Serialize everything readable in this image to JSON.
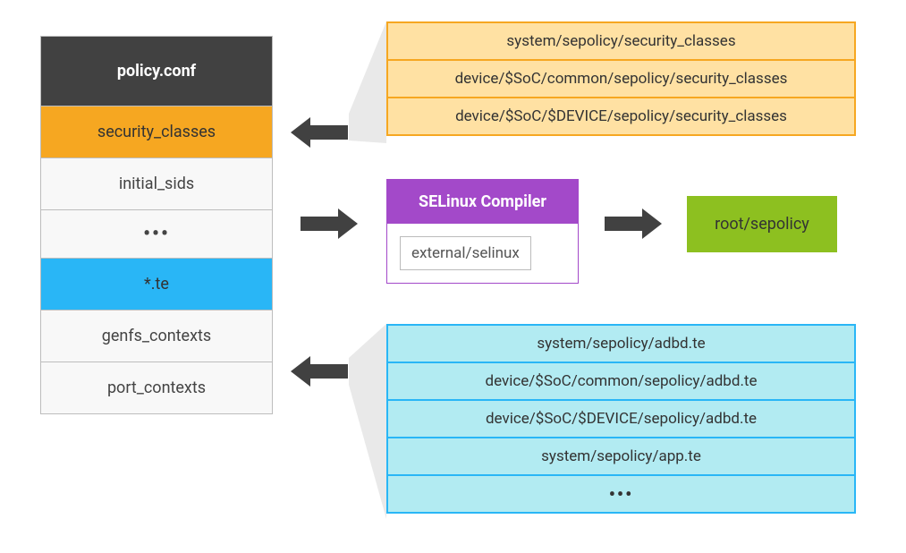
{
  "policy": {
    "header": "policy.conf",
    "rows": {
      "security_classes": "security_classes",
      "initial_sids": "initial_sids",
      "ellipsis": "•••",
      "te": "*.te",
      "genfs": "genfs_contexts",
      "port": "port_contexts"
    }
  },
  "security_table": {
    "r0": "system/sepolicy/security_classes",
    "r1": "device/$SoC/common/sepolicy/security_classes",
    "r2": "device/$SoC/$DEVICE/sepolicy/security_classes"
  },
  "compiler": {
    "title": "SELinux Compiler",
    "path": "external/selinux"
  },
  "output": {
    "label": "root/sepolicy"
  },
  "te_table": {
    "r0": "system/sepolicy/adbd.te",
    "r1": "device/$SoC/common/sepolicy/adbd.te",
    "r2": "device/$SoC/$DEVICE/sepolicy/adbd.te",
    "r3": "system/sepolicy/app.te",
    "r4": "•••"
  }
}
